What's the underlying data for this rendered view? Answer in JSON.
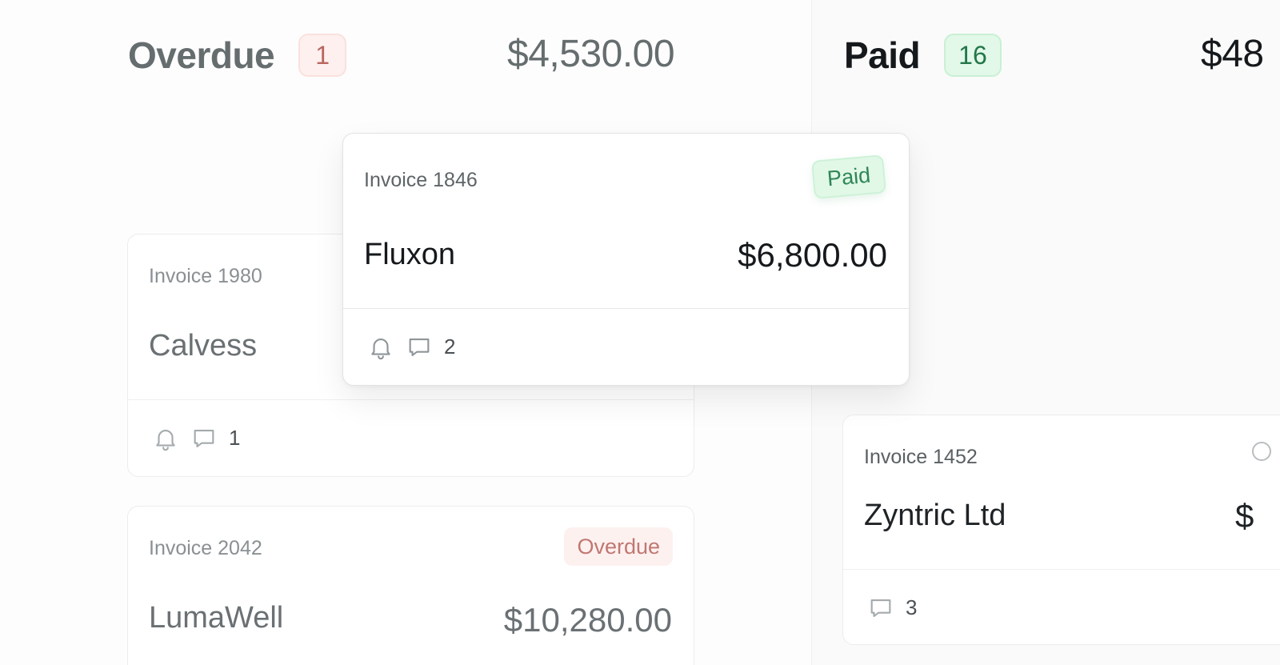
{
  "columns": {
    "overdue": {
      "title": "Overdue",
      "count": "1",
      "total": "$4,530.00"
    },
    "paid": {
      "title": "Paid",
      "count": "16",
      "total": "$48"
    }
  },
  "cards": {
    "calvess": {
      "invoice": "Invoice 1980",
      "client": "Calvess",
      "comments": "1"
    },
    "lumawell": {
      "invoice": "Invoice 2042",
      "client": "LumaWell",
      "amount": "$10,280.00",
      "status": "Overdue"
    },
    "zyntric": {
      "invoice": "Invoice 1452",
      "client": "Zyntric Ltd",
      "amount": "$",
      "comments": "3"
    },
    "fluxon": {
      "invoice": "Invoice 1846",
      "client": "Fluxon",
      "amount": "$6,800.00",
      "status": "Paid",
      "comments": "2"
    }
  },
  "icons": {
    "reminder": "bell-icon",
    "comments": "chat-bubble-icon"
  },
  "colors": {
    "overdue": "#c07871",
    "paid": "#2f8656"
  }
}
